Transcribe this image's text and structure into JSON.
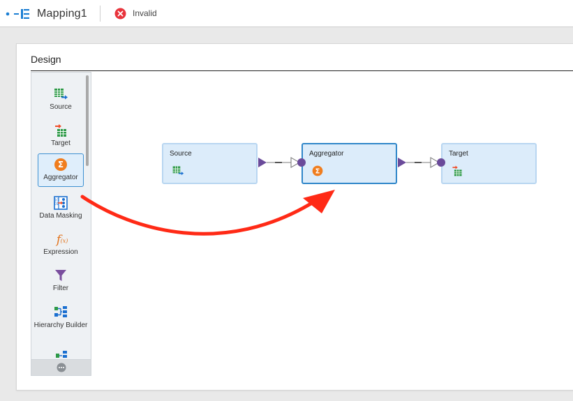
{
  "header": {
    "app_icon": "mapping-icon",
    "title": "Mapping1",
    "status_icon": "error-circle-icon",
    "status_text": "Invalid",
    "status_color": "#e8343c"
  },
  "design": {
    "title": "Design",
    "palette": [
      {
        "label": "Source",
        "icon": "source-icon"
      },
      {
        "label": "Target",
        "icon": "target-icon"
      },
      {
        "label": "Aggregator",
        "icon": "aggregator-icon",
        "selected": true
      },
      {
        "label": "Data Masking",
        "icon": "data-masking-icon"
      },
      {
        "label": "Expression",
        "icon": "expression-icon"
      },
      {
        "label": "Filter",
        "icon": "filter-icon"
      },
      {
        "label": "Hierarchy Builder",
        "icon": "hierarchy-builder-icon"
      }
    ],
    "more_icon": "more-icon"
  },
  "canvas": {
    "nodes": [
      {
        "label": "Source",
        "icon": "source-icon"
      },
      {
        "label": "Aggregator",
        "icon": "aggregator-icon",
        "selected": true
      },
      {
        "label": "Target",
        "icon": "target-icon"
      }
    ],
    "annotation_arrow_color": "#ff2a16",
    "link_color": "#6a4a9a"
  }
}
